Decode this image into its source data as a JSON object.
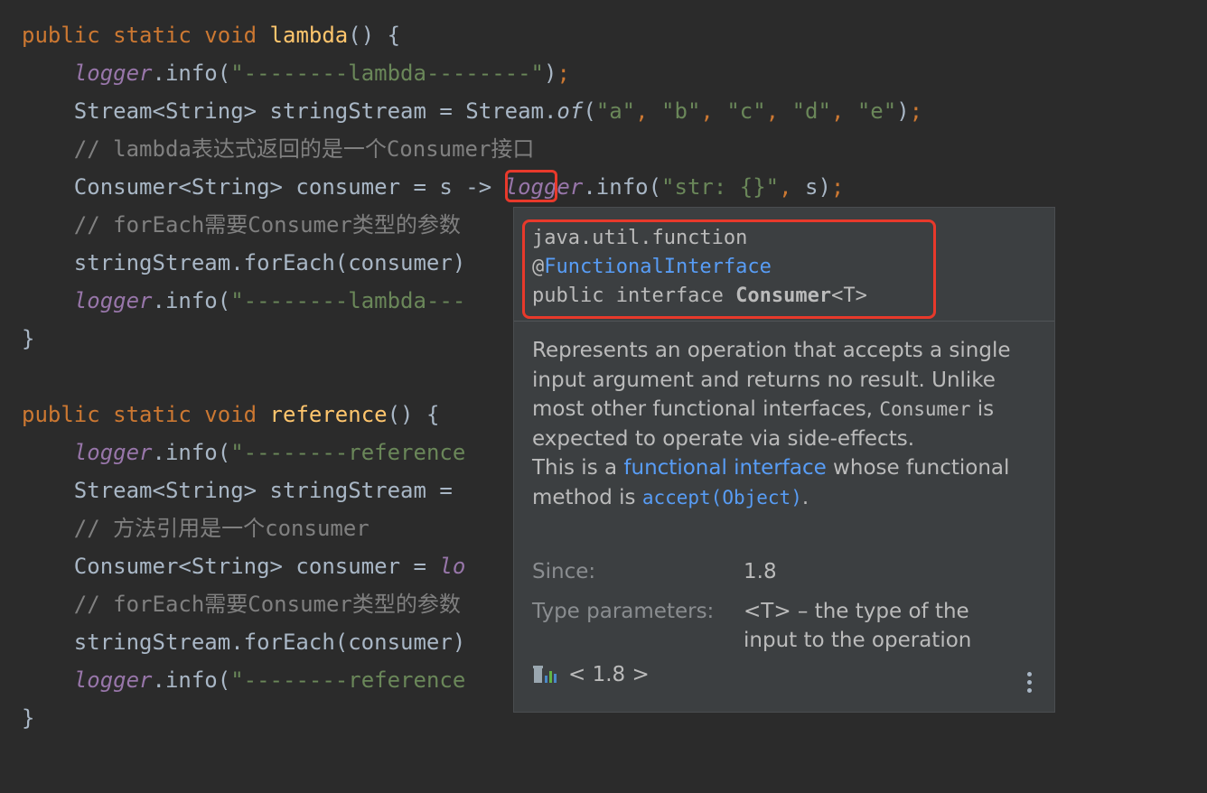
{
  "code": {
    "lines": [
      [
        [
          "kw",
          "public static void "
        ],
        [
          "fn",
          "lambda"
        ],
        [
          "",
          "() {"
        ]
      ],
      [
        [
          "",
          "    "
        ],
        [
          "field",
          "logger"
        ],
        [
          "",
          ".info("
        ],
        [
          "str",
          "\"--------lambda--------\""
        ],
        [
          "",
          ")"
        ],
        [
          "punc",
          ";"
        ]
      ],
      [
        [
          "",
          "    Stream<String> stringStream = Stream."
        ],
        [
          "st",
          "of"
        ],
        [
          "",
          "("
        ],
        [
          "str",
          "\"a\""
        ],
        [
          "punc",
          ", "
        ],
        [
          "str",
          "\"b\""
        ],
        [
          "punc",
          ", "
        ],
        [
          "str",
          "\"c\""
        ],
        [
          "punc",
          ", "
        ],
        [
          "str",
          "\"d\""
        ],
        [
          "punc",
          ", "
        ],
        [
          "str",
          "\"e\""
        ],
        [
          "",
          ")"
        ],
        [
          "punc",
          ";"
        ]
      ],
      [
        [
          "",
          "    "
        ],
        [
          "cmt",
          "// lambda表达式返回的是一个Consumer接口"
        ]
      ],
      [
        [
          "",
          "    Consumer<String> consumer = s "
        ],
        [
          "",
          "->"
        ],
        [
          "",
          ""
        ],
        [
          "",
          ""
        ],
        [
          "field",
          " logger"
        ],
        [
          "",
          ".info("
        ],
        [
          "str",
          "\"str: {}\""
        ],
        [
          "punc",
          ", "
        ],
        [
          "",
          "s)"
        ],
        [
          "punc",
          ";"
        ]
      ],
      [
        [
          "",
          "    "
        ],
        [
          "cmt",
          "// forEach需要Consumer类型的参数"
        ]
      ],
      [
        [
          "",
          "    stringStream.forEach(consumer)"
        ]
      ],
      [
        [
          "",
          "    "
        ],
        [
          "field",
          "logger"
        ],
        [
          "",
          ".info("
        ],
        [
          "str",
          "\"--------lambda---"
        ]
      ],
      [
        [
          "",
          "}"
        ]
      ],
      [
        [
          "",
          ""
        ]
      ],
      [
        [
          "kw",
          "public static void "
        ],
        [
          "fn",
          "reference"
        ],
        [
          "",
          "() {"
        ]
      ],
      [
        [
          "",
          "    "
        ],
        [
          "field",
          "logger"
        ],
        [
          "",
          ".info("
        ],
        [
          "str",
          "\"--------reference"
        ]
      ],
      [
        [
          "",
          "    Stream<String> stringStream = "
        ]
      ],
      [
        [
          "",
          "    "
        ],
        [
          "cmt",
          "// 方法引用是一个consumer"
        ]
      ],
      [
        [
          "",
          "    Consumer<String> consumer = "
        ],
        [
          "field",
          "lo"
        ]
      ],
      [
        [
          "",
          "    "
        ],
        [
          "cmt",
          "// forEach需要Consumer类型的参数"
        ]
      ],
      [
        [
          "",
          "    stringStream.forEach(consumer)"
        ]
      ],
      [
        [
          "",
          "    "
        ],
        [
          "field",
          "logger"
        ],
        [
          "",
          ".info("
        ],
        [
          "str",
          "\"--------reference"
        ]
      ],
      [
        [
          "",
          "}"
        ]
      ]
    ]
  },
  "popup": {
    "package": "java.util.function",
    "annotation_at": "@",
    "annotation": "FunctionalInterface",
    "decl_prefix": "public interface ",
    "decl_name": "Consumer",
    "decl_generic": "<T>",
    "desc_part1": "Represents an operation that accepts a single input argument and returns no result. Unlike most other functional interfaces, ",
    "desc_code": "Consumer",
    "desc_part2": " is expected to operate via side-effects.",
    "desc2_part1": "This is a ",
    "desc2_link": "functional interface",
    "desc2_part2": " whose functional method is ",
    "desc2_code_link": "accept(Object)",
    "desc2_end": ".",
    "since_label": "Since:",
    "since_value": "1.8",
    "type_params_label": "Type parameters:",
    "type_params_value": "<T> – the type of the input to the operation",
    "library": "< 1.8 >"
  },
  "icons": {
    "library": "library-icon",
    "more": "more-vertical-icon"
  }
}
